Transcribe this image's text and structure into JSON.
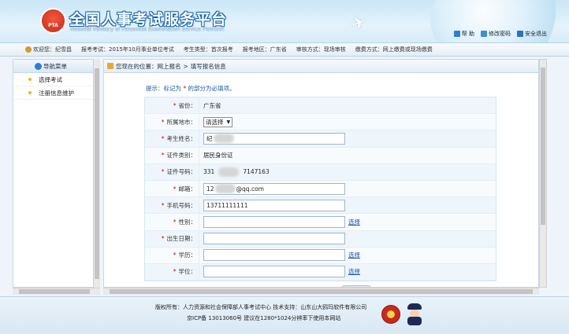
{
  "header": {
    "title_cn": "全国人事考试服务平台",
    "title_en": "National Ministry of Personnel Examination Service Platform",
    "logo_text": "PTA",
    "links": [
      {
        "label": "帮 助",
        "icon": "help-icon"
      },
      {
        "label": "修改密码",
        "icon": "key-icon"
      },
      {
        "label": "安全退出",
        "icon": "logout-icon"
      }
    ]
  },
  "infobar": {
    "welcome": "欢迎您：纪雪昌",
    "exam": "报考考试：2015年10月事业单位考试",
    "type": "考生类型：首次报考",
    "region": "报考地区：广东省",
    "review": "审核方式：现场审核",
    "payment": "缴费方式：网上缴费或现场缴费"
  },
  "sidebar": {
    "title": "导航菜单",
    "items": [
      {
        "label": "选择考试"
      },
      {
        "label": "注册信息维护"
      }
    ]
  },
  "breadcrumb": {
    "prefix": "您现在的位置：网上报名",
    "sep": ">",
    "current": "填写报名信息"
  },
  "hint": {
    "before": "提示：标记为",
    "star": "*",
    "after": "的部分为必填项。"
  },
  "form": {
    "province_label": "省份：",
    "province_value": "广东省",
    "city_label": "所属地市：",
    "city_value": "请选择",
    "name_label": "考生姓名：",
    "name_value": "纪",
    "idtype_label": "证件类别：",
    "idtype_value": "居民身份证",
    "idno_label": "证件号码：",
    "idno_prefix": "331",
    "idno_suffix": "7147163",
    "email_label": "邮箱：",
    "email_prefix": "12",
    "email_suffix": "@qq.com",
    "phone_label": "手机号码：",
    "phone_value": "13711111111",
    "gender_label": "性别：",
    "birth_label": "出生日期：",
    "edu_label": "学历：",
    "degree_label": "学位：",
    "choose": "选择"
  },
  "footer": {
    "line1": "版权所有：人力资源和社会保障部人事考试中心  技术支持：山东山大鸥玛软件有限公司",
    "line2": "京ICP备 13013060号  建议在1280*1024分辨率下使用本网站"
  }
}
